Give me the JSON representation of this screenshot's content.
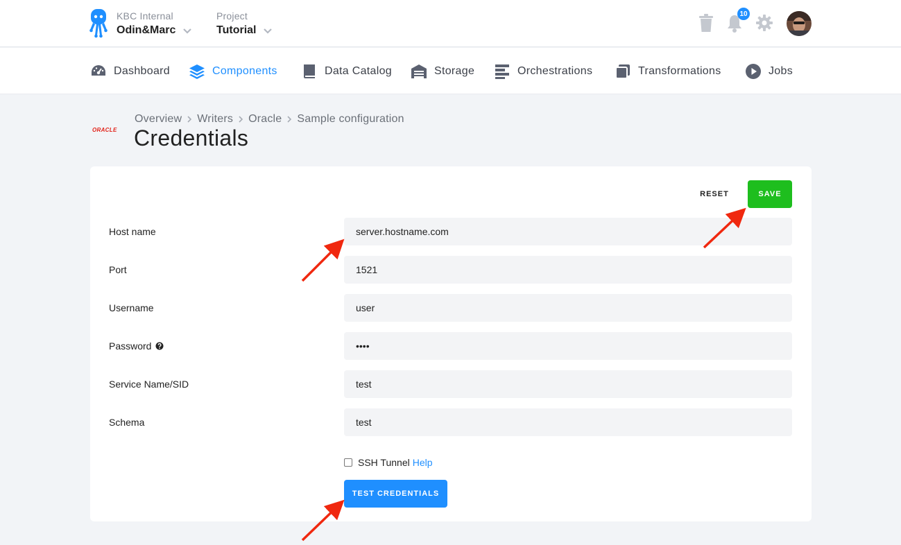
{
  "header": {
    "org_label": "KBC Internal",
    "org_name": "Odin&Marc",
    "project_label": "Project",
    "project_name": "Tutorial",
    "notifications_count": "10"
  },
  "nav": {
    "items": [
      {
        "label": "Dashboard",
        "icon": "dashboard-icon",
        "active": false
      },
      {
        "label": "Components",
        "icon": "layers-icon",
        "active": true
      },
      {
        "label": "Data Catalog",
        "icon": "book-icon",
        "active": false
      },
      {
        "label": "Storage",
        "icon": "warehouse-icon",
        "active": false
      },
      {
        "label": "Orchestrations",
        "icon": "bars-icon",
        "active": false
      },
      {
        "label": "Transformations",
        "icon": "copy-icon",
        "active": false
      },
      {
        "label": "Jobs",
        "icon": "play-circle-icon",
        "active": false
      }
    ]
  },
  "page": {
    "logo_text": "ORACLE",
    "breadcrumb": [
      "Overview",
      "Writers",
      "Oracle",
      "Sample configuration"
    ],
    "title": "Credentials"
  },
  "actions": {
    "reset_label": "RESET",
    "save_label": "SAVE"
  },
  "form": {
    "fields": [
      {
        "label": "Host name",
        "value": "server.hostname.com"
      },
      {
        "label": "Port",
        "value": "1521"
      },
      {
        "label": "Username",
        "value": "user"
      },
      {
        "label": "Password",
        "value": "••••"
      },
      {
        "label": "Service Name/SID",
        "value": "test"
      },
      {
        "label": "Schema",
        "value": "test"
      }
    ],
    "ssh_tunnel_label": "SSH Tunnel",
    "ssh_tunnel_checked": false,
    "help_link": "Help",
    "test_button_label": "TEST CREDENTIALS"
  },
  "colors": {
    "accent": "#1f8fff",
    "save_green": "#1ebe1e",
    "arrow_red": "#f0280f",
    "oracle_red": "#e2231a"
  }
}
